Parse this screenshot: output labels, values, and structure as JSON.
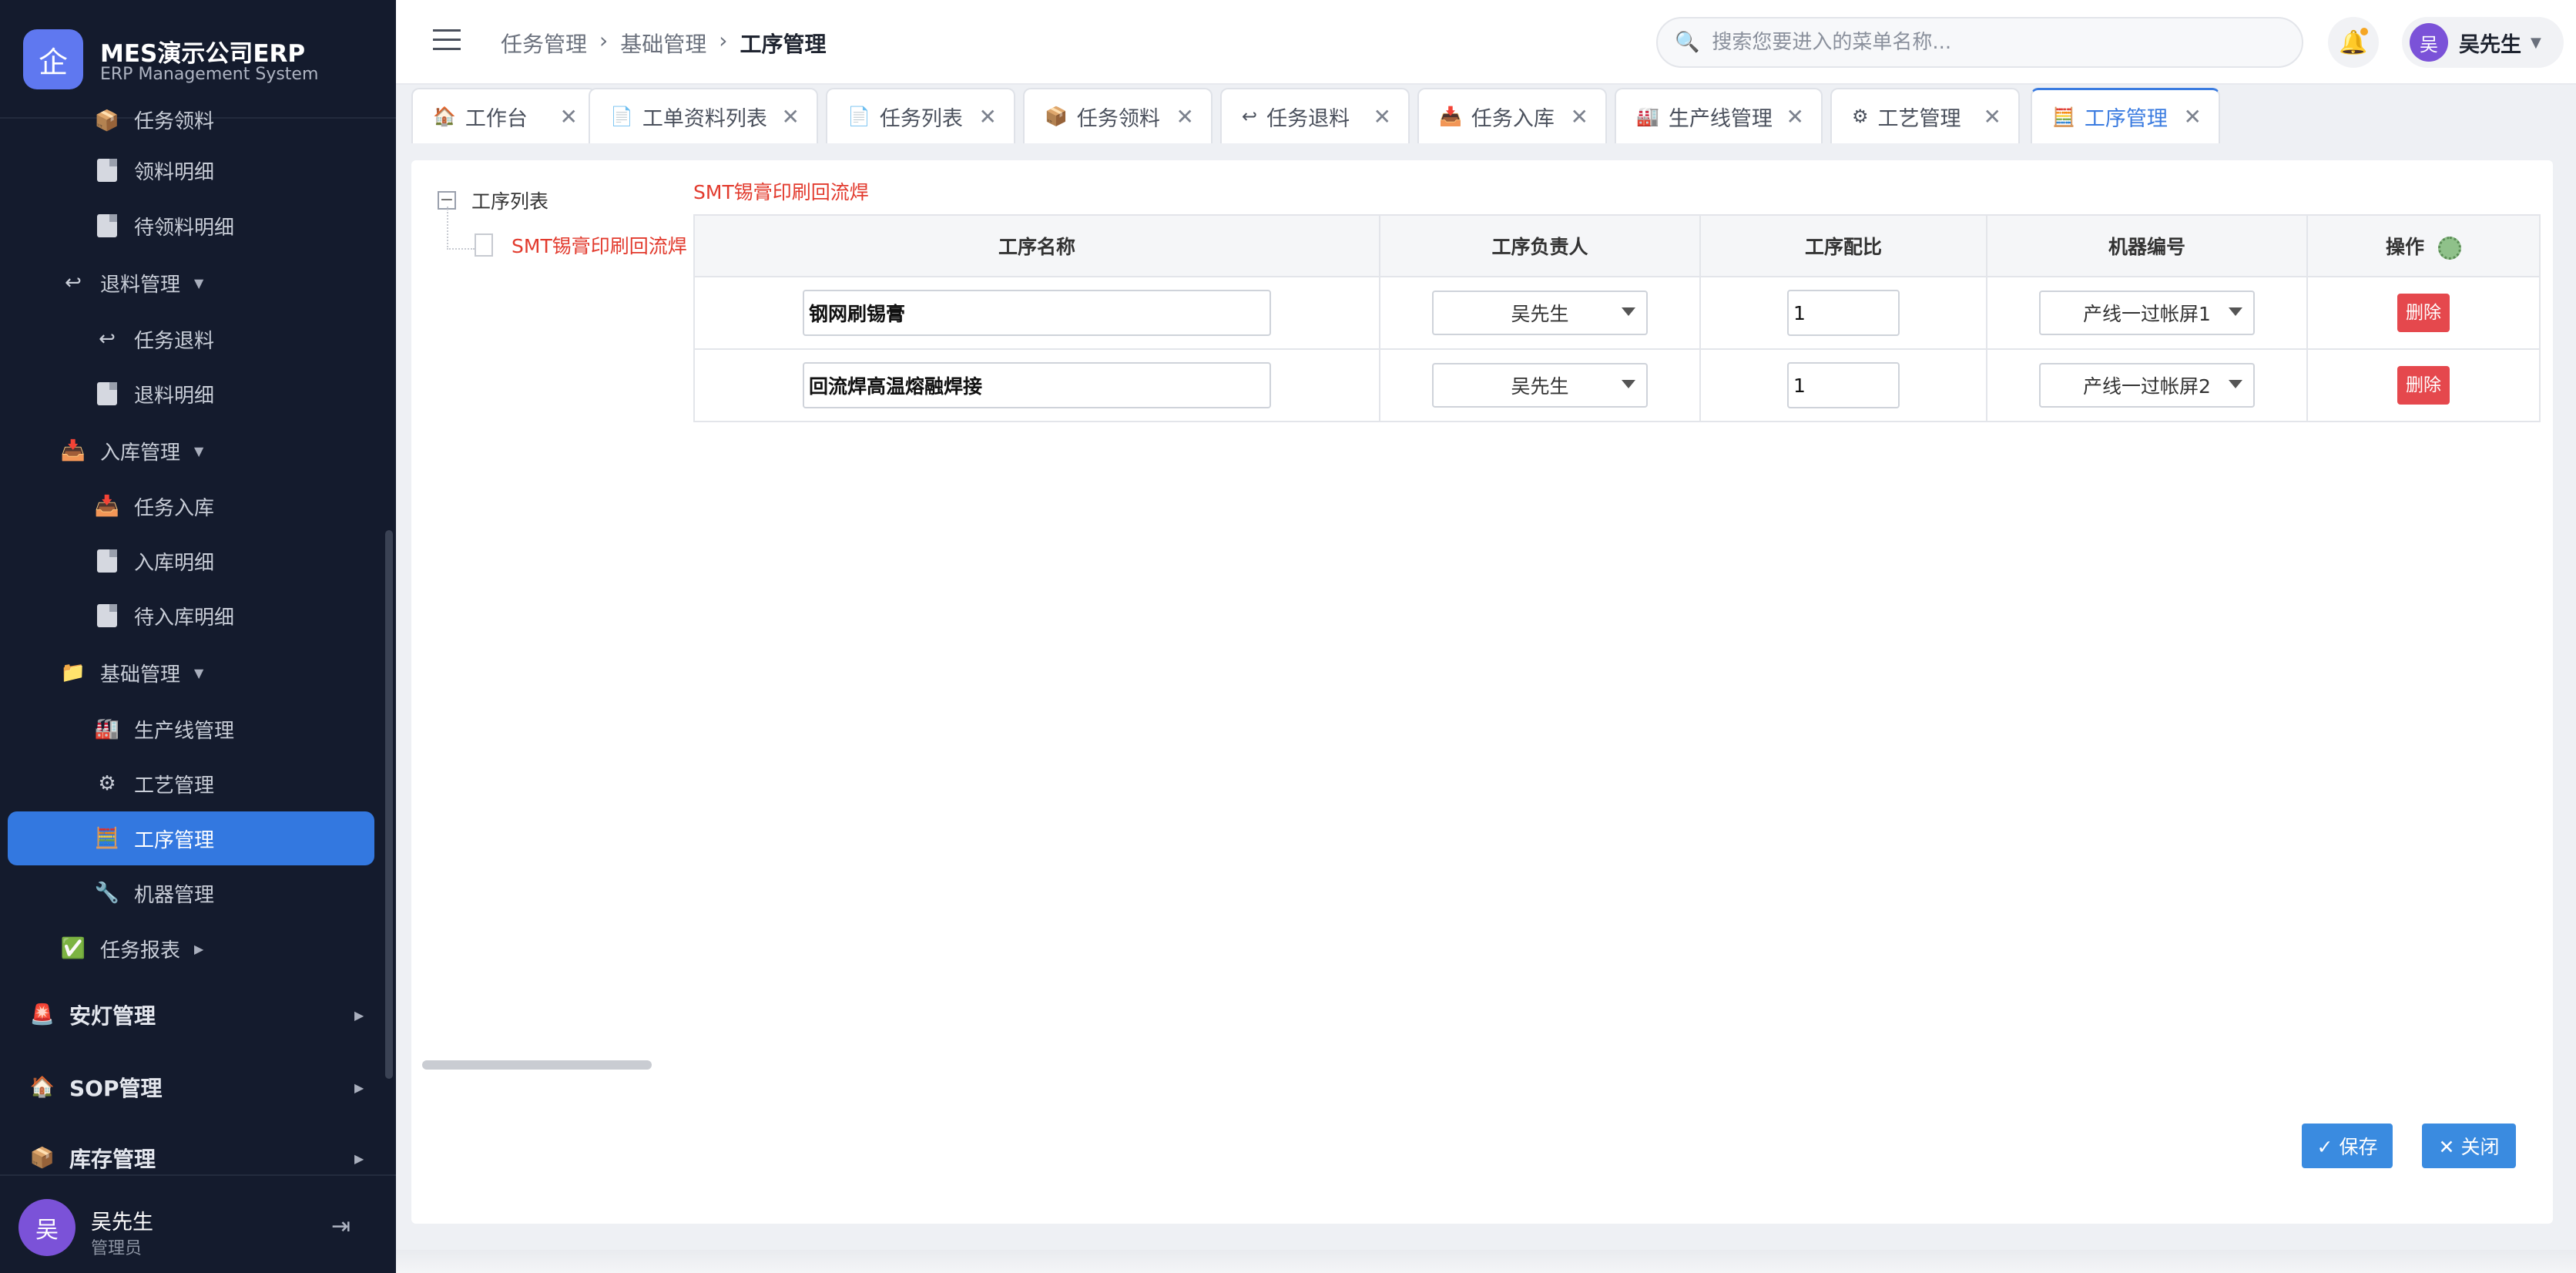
{
  "brand": {
    "logo_char": "企",
    "title": "MES演示公司ERP",
    "subtitle": "ERP Management System"
  },
  "sidebar": {
    "items": [
      {
        "label": "任务领料",
        "level": 3,
        "icon": "document-icon"
      },
      {
        "label": "领料明细",
        "level": 3,
        "icon": "document-icon"
      },
      {
        "label": "待领料明细",
        "level": 3,
        "icon": "document-icon"
      },
      {
        "label": "退料管理",
        "level": 2,
        "icon": "return-icon",
        "arrow": "▼"
      },
      {
        "label": "任务退料",
        "level": 3,
        "icon": "return-icon"
      },
      {
        "label": "退料明细",
        "level": 3,
        "icon": "document-icon"
      },
      {
        "label": "入库管理",
        "level": 2,
        "icon": "inbox-tray-icon",
        "arrow": "▼"
      },
      {
        "label": "任务入库",
        "level": 3,
        "icon": "inbox-tray-icon"
      },
      {
        "label": "入库明细",
        "level": 3,
        "icon": "document-icon"
      },
      {
        "label": "待入库明细",
        "level": 3,
        "icon": "document-icon"
      },
      {
        "label": "基础管理",
        "level": 2,
        "icon": "folder-icon",
        "arrow": "▼"
      },
      {
        "label": "生产线管理",
        "level": 3,
        "icon": "factory-icon"
      },
      {
        "label": "工艺管理",
        "level": 3,
        "icon": "gear-icon"
      },
      {
        "label": "工序管理",
        "level": 3,
        "icon": "abacus-icon",
        "active": true
      },
      {
        "label": "机器管理",
        "level": 3,
        "icon": "wrench-icon"
      },
      {
        "label": "任务报表",
        "level": 2,
        "icon": "check-icon",
        "arrow": "▶"
      },
      {
        "label": "安灯管理",
        "level": 1,
        "icon": "siren-icon",
        "arrow": "▶"
      },
      {
        "label": "SOP管理",
        "level": 1,
        "icon": "house-icon",
        "arrow": "▶"
      },
      {
        "label": "库存管理",
        "level": 1,
        "icon": "package-icon",
        "arrow": "▶"
      }
    ],
    "user": {
      "avatar": "吴",
      "name": "吴先生",
      "role": "管理员"
    }
  },
  "header": {
    "breadcrumb": [
      "任务管理",
      "基础管理",
      "工序管理"
    ],
    "search_placeholder": "搜索您要进入的菜单名称...",
    "user_avatar": "吴",
    "user_name": "吴先生"
  },
  "tabs": [
    {
      "label": "工作台",
      "icon": "house-icon"
    },
    {
      "label": "工单资料列表",
      "icon": "document-icon"
    },
    {
      "label": "任务列表",
      "icon": "document-icon"
    },
    {
      "label": "任务领料",
      "icon": "package-icon"
    },
    {
      "label": "任务退料",
      "icon": "return-icon"
    },
    {
      "label": "任务入库",
      "icon": "inbox-tray-icon"
    },
    {
      "label": "生产线管理",
      "icon": "factory-icon"
    },
    {
      "label": "工艺管理",
      "icon": "gear-icon"
    },
    {
      "label": "工序管理",
      "icon": "abacus-icon",
      "active": true
    }
  ],
  "tree": {
    "root": "工序列表",
    "child": "SMT锡膏印刷回流焊"
  },
  "route_title": "SMT锡膏印刷回流焊",
  "grid": {
    "columns": [
      "工序名称",
      "工序负责人",
      "工序配比",
      "机器编号",
      "操作"
    ],
    "rows": [
      {
        "name": "钢网刷锡膏",
        "owner": "吴先生",
        "ratio": "1",
        "machine": "产线一过帐屏1",
        "action": "删除"
      },
      {
        "name": "回流焊高温熔融焊接",
        "owner": "吴先生",
        "ratio": "1",
        "machine": "产线一过帐屏2",
        "action": "删除"
      }
    ]
  },
  "buttons": {
    "save": "✓ 保存",
    "close": "✕ 关闭"
  },
  "colors": {
    "sidebar_bg": "#141b2d",
    "accent": "#3378e0",
    "danger": "#e5484d",
    "red_text": "#e23a2d"
  }
}
